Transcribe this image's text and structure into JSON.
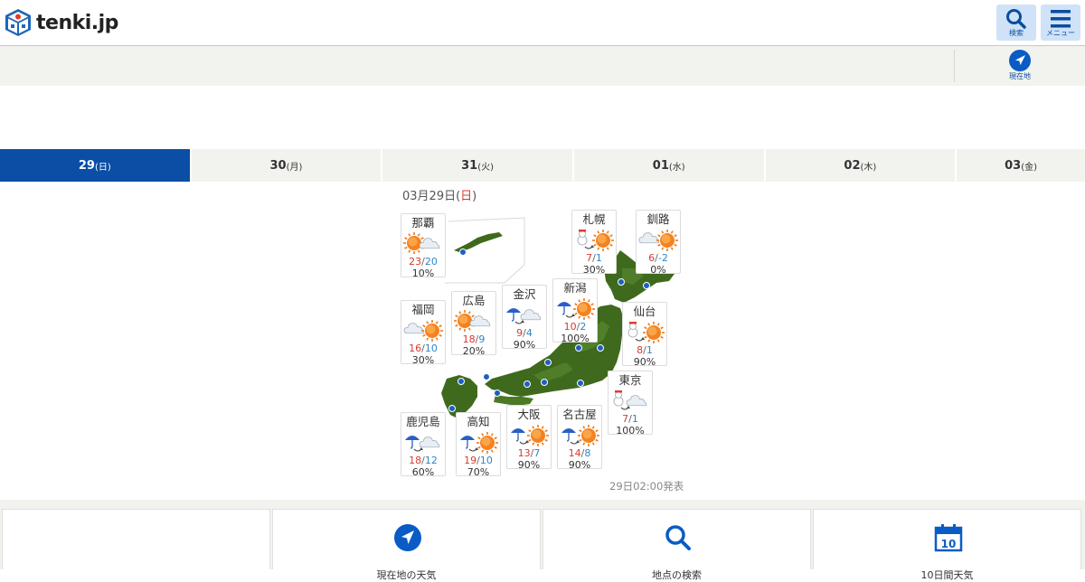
{
  "header": {
    "logo_text": "tenki.jp",
    "search_label": "検索",
    "menu_label": "メニュー"
  },
  "subbar": {
    "location_label": "現在地"
  },
  "tabs": [
    {
      "day": "29",
      "weekday": "(日)",
      "active": true
    },
    {
      "day": "30",
      "weekday": "(月)",
      "active": false
    },
    {
      "day": "31",
      "weekday": "(火)",
      "active": false
    },
    {
      "day": "01",
      "weekday": "(水)",
      "active": false
    },
    {
      "day": "02",
      "weekday": "(木)",
      "active": false
    },
    {
      "day": "03",
      "weekday": "(金)",
      "active": false
    }
  ],
  "map": {
    "date_prefix": "03月29日(",
    "date_weekday": "日",
    "date_suffix": ")",
    "announce": "29日02:00発表",
    "cities": [
      {
        "name": "那覇",
        "icon": "sun-then-cloud",
        "high": "23",
        "sep": "/",
        "low": "20",
        "pop": "10%"
      },
      {
        "name": "札幌",
        "icon": "snow-then-sun",
        "high": "7",
        "sep": "/",
        "low": "1",
        "pop": "30%"
      },
      {
        "name": "釧路",
        "icon": "cloud-then-sun",
        "high": "6",
        "sep": "/",
        "low": "-2",
        "pop": "0%"
      },
      {
        "name": "福岡",
        "icon": "cloud-then-sun",
        "high": "16",
        "sep": "/",
        "low": "10",
        "pop": "30%"
      },
      {
        "name": "広島",
        "icon": "sun-then-cloud",
        "high": "18",
        "sep": "/",
        "low": "9",
        "pop": "20%"
      },
      {
        "name": "金沢",
        "icon": "rain-then-cloud",
        "high": "9",
        "sep": "/",
        "low": "4",
        "pop": "90%"
      },
      {
        "name": "新潟",
        "icon": "rain-then-sun",
        "high": "10",
        "sep": "/",
        "low": "2",
        "pop": "100%"
      },
      {
        "name": "仙台",
        "icon": "snow-then-sun",
        "high": "8",
        "sep": "/",
        "low": "1",
        "pop": "90%"
      },
      {
        "name": "東京",
        "icon": "snow-then-cloud",
        "high": "7",
        "sep": "/",
        "low": "1",
        "pop": "100%"
      },
      {
        "name": "鹿児島",
        "icon": "rain-then-cloud",
        "high": "18",
        "sep": "/",
        "low": "12",
        "pop": "60%"
      },
      {
        "name": "高知",
        "icon": "rain-then-sun",
        "high": "19",
        "sep": "/",
        "low": "10",
        "pop": "70%"
      },
      {
        "name": "大阪",
        "icon": "rain-then-sun",
        "high": "13",
        "sep": "/",
        "low": "7",
        "pop": "90%"
      },
      {
        "name": "名古屋",
        "icon": "rain-then-sun",
        "high": "14",
        "sep": "/",
        "low": "8",
        "pop": "90%"
      }
    ]
  },
  "bottom_cards": [
    {
      "icon": "none",
      "label": ""
    },
    {
      "icon": "location-arrow-icon",
      "label": "現在地の天気"
    },
    {
      "icon": "search-icon",
      "label": "地点の検索"
    },
    {
      "icon": "calendar-icon",
      "label": "10日間天気"
    }
  ],
  "colors": {
    "accent": "#0a4ea5",
    "high_temp": "#d63a2f",
    "low_temp": "#2f86c8",
    "land": "#3f6a1e"
  }
}
